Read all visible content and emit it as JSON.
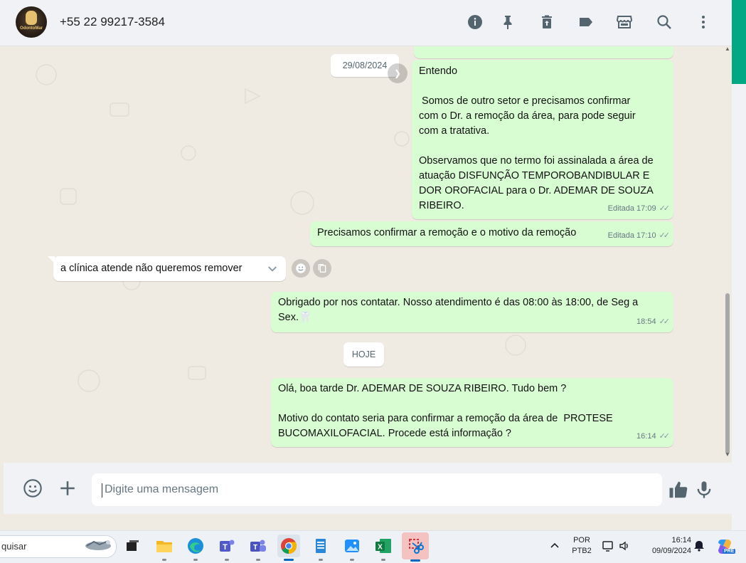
{
  "header": {
    "contact_name": "+55 22 99217-3584",
    "avatar_logo_text": "OdontoMar",
    "icons": [
      "info-icon",
      "pin-icon",
      "delete-icon",
      "label-icon",
      "store-icon",
      "search-icon",
      "more-vert-icon"
    ]
  },
  "messages": {
    "date_chip_1": "29/08/2024",
    "msg1": {
      "lines": [
        "Entendo",
        "",
        " Somos de outro setor e precisamos confirmar",
        "com o Dr. a remoção da área, para pode seguir",
        "com a tratativa.",
        "",
        "Observamos que no termo foi assinalada a área de",
        "atuação DISFUNÇÃO TEMPOROBANDIBULAR E",
        "DOR OROFACIAL para o Dr. ADEMAR DE SOUZA",
        "RIBEIRO."
      ],
      "meta": "Editada 17:09"
    },
    "msg2": {
      "text": "Precisamos confirmar a remoção e o motivo da remoção",
      "meta": "Editada 17:10"
    },
    "msg3": {
      "text": "a clínica atende não queremos remover"
    },
    "msg4": {
      "line1": "Obrigado por nos contatar. Nosso atendimento é das 08:00 às 18:00, de Seg a",
      "line2": "Sex.",
      "emoji": "🦷",
      "time": "18:54"
    },
    "date_chip_2": "HOJE",
    "msg5": {
      "lines": [
        "Olá, boa tarde Dr. ADEMAR DE SOUZA RIBEIRO. Tudo bem ?",
        "",
        "Motivo do contato seria para confirmar a remoção da área de  PROTESE",
        "BUCOMAXILOFACIAL. Procede está informação ?"
      ],
      "time": "16:14"
    }
  },
  "compose": {
    "placeholder": "Digite uma mensagem"
  },
  "taskbar": {
    "search_text": "quisar",
    "apps": [
      "search-highlight-icon",
      "task-view-icon",
      "file-explorer-icon",
      "edge-icon",
      "teams-icon",
      "teams-classic-icon",
      "chrome-icon",
      "notepad-icon",
      "photos-icon",
      "excel-icon",
      "snipping-tool-icon"
    ],
    "language_line1": "POR",
    "language_line2": "PTB2",
    "clock_time": "16:14",
    "clock_date": "09/09/2024",
    "copilot_badge": "PRE"
  },
  "colors": {
    "accent": "#00a884",
    "outgoing_bubble": "#d9fdd3",
    "incoming_bubble": "#ffffff",
    "chat_background": "#efeae2",
    "header_background": "#f0f2f5"
  }
}
